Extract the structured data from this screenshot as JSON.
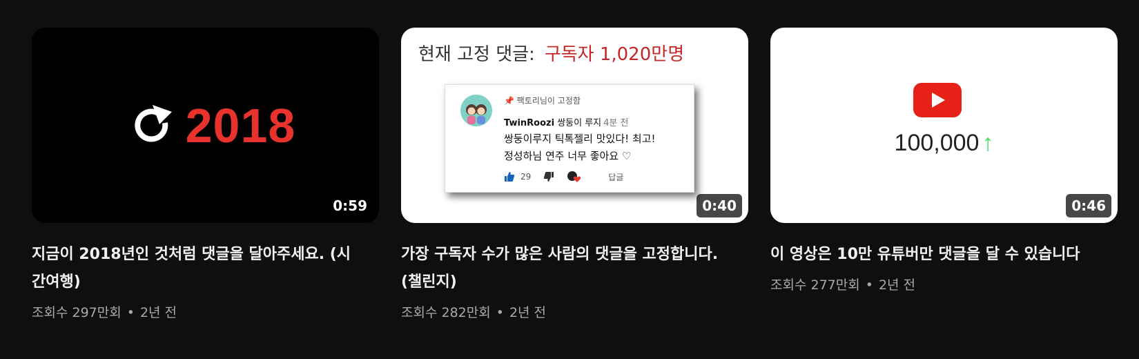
{
  "videos": [
    {
      "duration": "0:59",
      "title": "지금이 2018년인 것처럼 댓글을 달아주세요. (시간여행)",
      "views": "조회수 297만회",
      "age": "2년 전",
      "thumbnail": {
        "icon": "replay-icon",
        "year": "2018",
        "accent": "#e8322d"
      }
    },
    {
      "duration": "0:40",
      "title": "가장 구독자 수가 많은 사람의 댓글을 고정합니다. (챌린지)",
      "views": "조회수 282만회",
      "age": "2년 전",
      "thumbnail": {
        "header_label": "현재 고정 댓글:",
        "header_value": "구독자 1,020만명",
        "pinned_by": "팩토리님이 고정함",
        "author": "TwinRoozi",
        "author_sub": "쌍둥이 루지",
        "time": "4분 전",
        "line1": "쌍둥이루지 틱톡젤리 맛있다! 최고!",
        "line2": "정성하님 연주 너무 좋아요 ♡",
        "likes": "29",
        "reply": "답글"
      }
    },
    {
      "duration": "0:46",
      "title": "이 영상은 10만 유튜버만 댓글을 달 수 있습니다",
      "views": "조회수 277만회",
      "age": "2년 전",
      "thumbnail": {
        "icon": "youtube-logo-icon",
        "count": "100,000",
        "arrow": "↑",
        "accent": "#4cd964"
      }
    }
  ],
  "separator": "•"
}
